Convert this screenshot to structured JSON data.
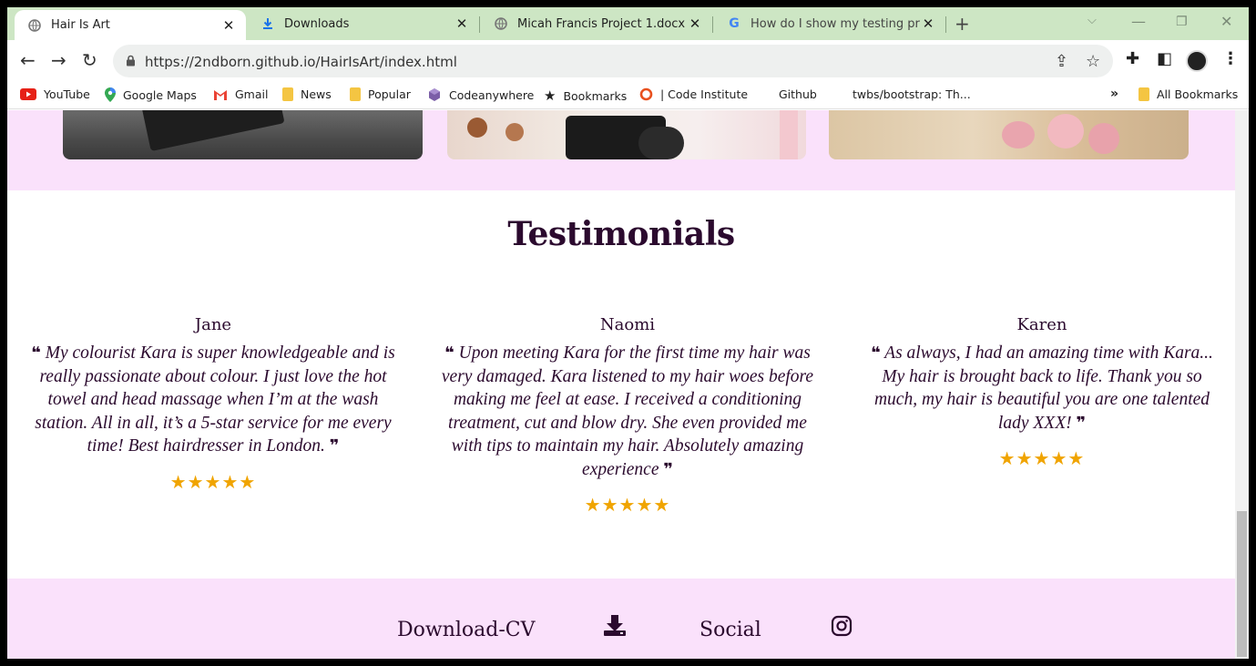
{
  "browser": {
    "tabs": [
      {
        "title": "Hair Is Art",
        "icon": "globe-icon",
        "active": true
      },
      {
        "title": "Downloads",
        "icon": "download-icon",
        "active": false
      },
      {
        "title": "Micah Francis Project 1.docx",
        "icon": "globe-icon",
        "active": false
      },
      {
        "title": "How do I show my testing proce",
        "icon": "google-icon",
        "active": false
      }
    ],
    "url": "https://2ndborn.github.io/HairIsArt/index.html",
    "bookmarks": [
      {
        "label": "YouTube",
        "icon": "youtube-icon"
      },
      {
        "label": "Google Maps",
        "icon": "maps-pin-icon"
      },
      {
        "label": "Gmail",
        "icon": "gmail-icon"
      },
      {
        "label": "News",
        "icon": "folder-icon"
      },
      {
        "label": "Popular",
        "icon": "folder-icon"
      },
      {
        "label": "Codeanywhere",
        "icon": "cube-icon"
      },
      {
        "label": "Bookmarks",
        "icon": "star-icon"
      },
      {
        "label": "| Code Institute",
        "icon": "ring-icon"
      },
      {
        "label": "Github",
        "icon": "none"
      },
      {
        "label": "twbs/bootstrap: Th...",
        "icon": "none"
      }
    ],
    "overflow_label": "»",
    "all_bookmarks_label": "All Bookmarks",
    "colors": {
      "tabstrip": "#cde6c4",
      "omnibox": "#eef0ef"
    }
  },
  "page": {
    "testimonials_title": "Testimonials",
    "testimonials": [
      {
        "name": "Jane",
        "quote": "My colourist Kara is super knowledgeable and is really passionate about colour. I just love the hot towel and head massage when I’m at the wash station. All in all, it’s a 5-star service for me every time! Best hairdresser in London.",
        "stars": "★★★★★"
      },
      {
        "name": "Naomi",
        "quote": "Upon meeting Kara for the first time my hair was very damaged. Kara listened to my hair woes before making me feel at ease. I received a conditioning treatment, cut and blow dry. She even provided me with tips to maintain my hair. Absolutely amazing experience",
        "stars": "★★★★★"
      },
      {
        "name": "Karen",
        "quote": "As always, I had an amazing time with Kara... My hair is brought back to life. Thank you so much, my hair is beautiful you are one talented lady XXX!",
        "stars": "★★★★★"
      }
    ],
    "quote_open": "❝",
    "quote_close": "❞",
    "footer": {
      "download_label": "Download-CV",
      "social_label": "Social"
    },
    "colors": {
      "pink_band": "#fae1fb",
      "text": "#2b0a2e",
      "stars": "#f0a400"
    }
  }
}
